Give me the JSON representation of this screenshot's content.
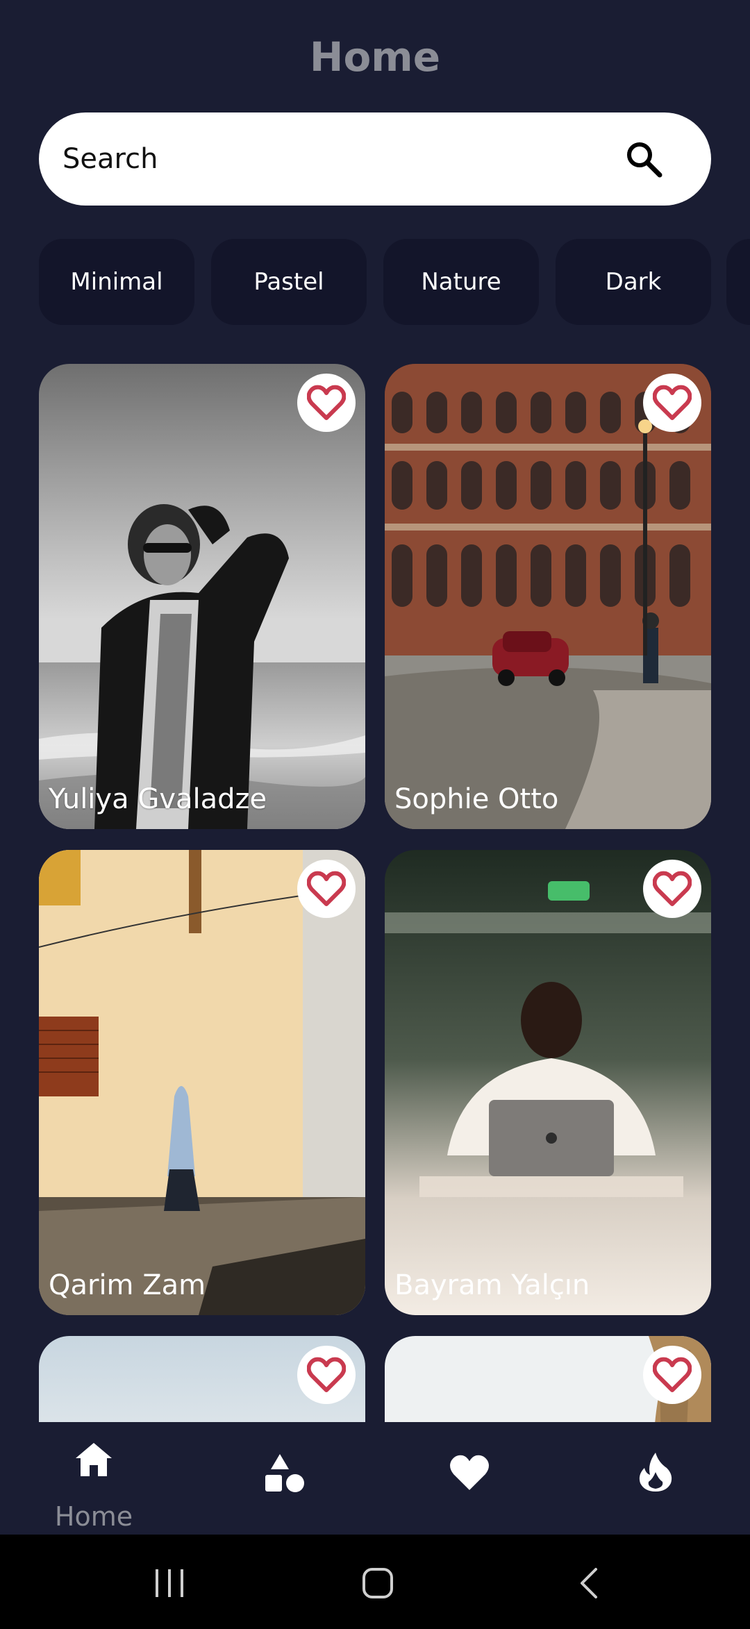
{
  "header": {
    "title": "Home"
  },
  "search": {
    "placeholder": "Search"
  },
  "categories": [
    "Minimal",
    "Pastel",
    "Nature",
    "Dark"
  ],
  "photos": [
    {
      "author": "Yuliya Gvaladze"
    },
    {
      "author": "Sophie Otto"
    },
    {
      "author": "Qarim Zam"
    },
    {
      "author": "Bayram  Yalçın"
    }
  ],
  "bottom_nav": {
    "items": [
      {
        "icon": "home-icon",
        "label": "Home",
        "active": true
      },
      {
        "icon": "categories-icon"
      },
      {
        "icon": "heart-icon"
      },
      {
        "icon": "fire-icon"
      }
    ]
  },
  "system_nav": {
    "icons": [
      "recent-apps-icon",
      "home-circle-icon",
      "back-icon"
    ]
  },
  "colors": {
    "background": "#1a1d33",
    "chip": "#13152a",
    "accent_heart": "#c93a4f",
    "muted_text": "#8b8d96"
  }
}
